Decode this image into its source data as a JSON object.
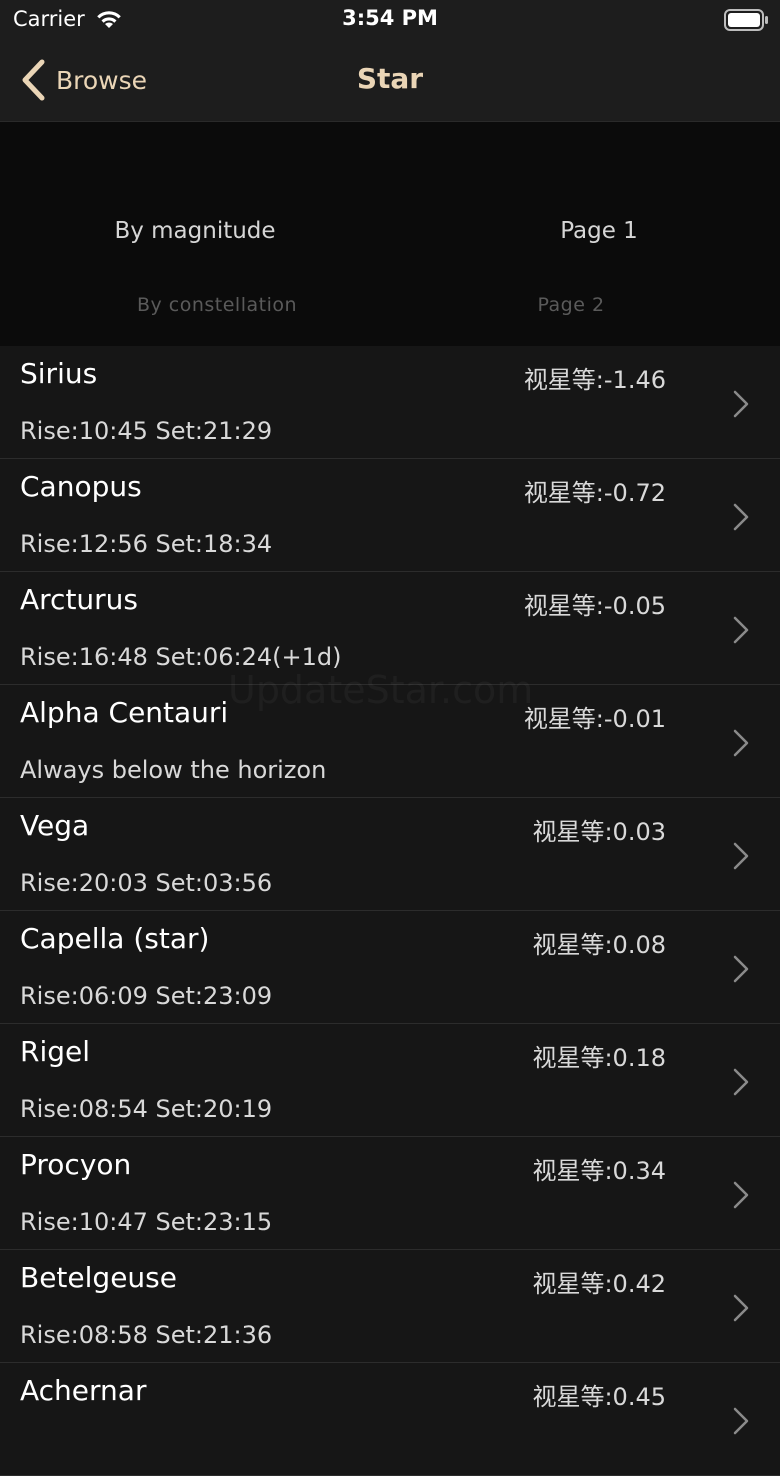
{
  "status_bar": {
    "carrier": "Carrier",
    "time": "3:54 PM"
  },
  "nav": {
    "back_label": "Browse",
    "title": "Star"
  },
  "picker": {
    "left": {
      "selected": "By magnitude",
      "next": "By constellation"
    },
    "right": {
      "selected": "Page 1",
      "next": "Page 2"
    }
  },
  "colors": {
    "accent": "#ead5b6",
    "background": "#0b0b0b",
    "row_background": "#161616"
  },
  "stars": [
    {
      "name": "Sirius",
      "magnitude": "视星等:-1.46",
      "times": "Rise:10:45 Set:21:29"
    },
    {
      "name": "Canopus",
      "magnitude": "视星等:-0.72",
      "times": "Rise:12:56 Set:18:34"
    },
    {
      "name": "Arcturus",
      "magnitude": "视星等:-0.05",
      "times": "Rise:16:48 Set:06:24(+1d)"
    },
    {
      "name": "Alpha Centauri",
      "magnitude": "视星等:-0.01",
      "times": "Always below the horizon"
    },
    {
      "name": "Vega",
      "magnitude": "视星等:0.03",
      "times": "Rise:20:03 Set:03:56"
    },
    {
      "name": "Capella (star)",
      "magnitude": "视星等:0.08",
      "times": "Rise:06:09 Set:23:09"
    },
    {
      "name": "Rigel",
      "magnitude": "视星等:0.18",
      "times": "Rise:08:54 Set:20:19"
    },
    {
      "name": "Procyon",
      "magnitude": "视星等:0.34",
      "times": "Rise:10:47 Set:23:15"
    },
    {
      "name": "Betelgeuse",
      "magnitude": "视星等:0.42",
      "times": "Rise:08:58 Set:21:36"
    },
    {
      "name": "Achernar",
      "magnitude": "视星等:0.45",
      "times": ""
    }
  ],
  "watermark": "UpdateStar.com"
}
